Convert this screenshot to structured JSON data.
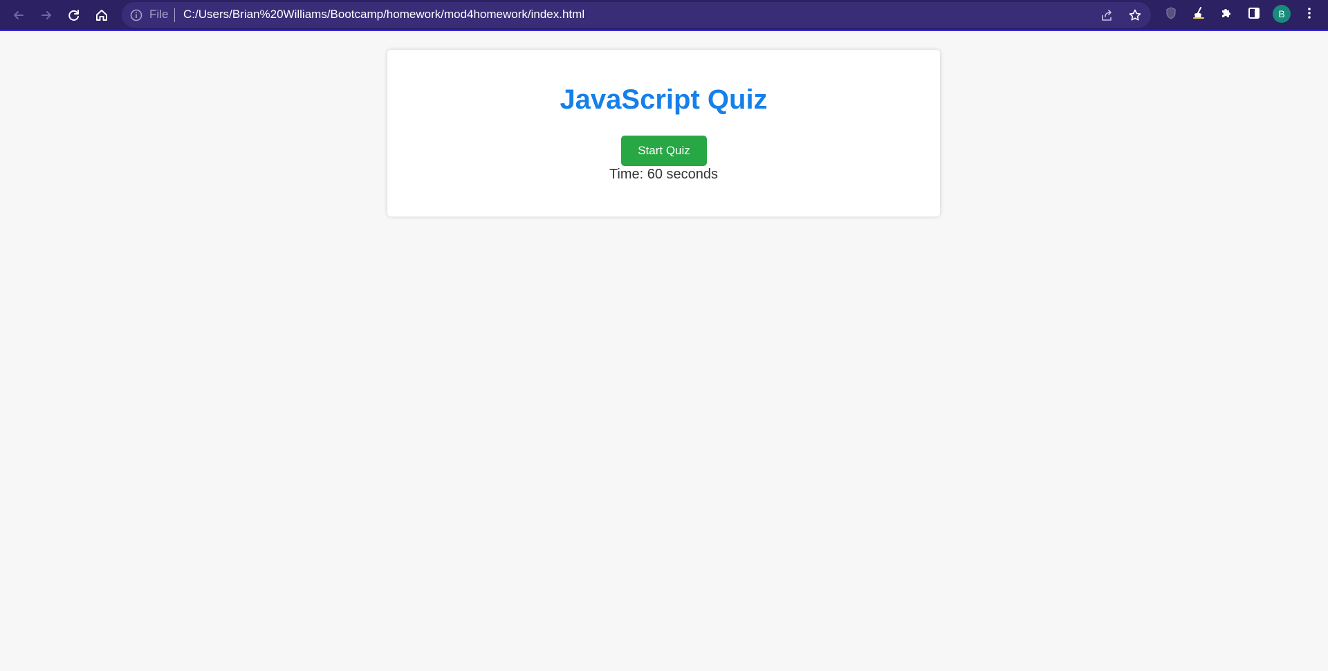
{
  "browser": {
    "scheme_label": "File",
    "url": "C:/Users/Brian%20Williams/Bootcamp/homework/mod4homework/index.html",
    "profile_initial": "B",
    "icons": {
      "back": "arrow-left-icon",
      "forward": "arrow-right-icon",
      "reload": "reload-icon",
      "home": "home-icon",
      "info": "info-icon",
      "share": "share-icon",
      "bookmark": "star-icon",
      "extension_shield": "shield-icon",
      "extension_broom": "broom-icon",
      "extensions": "puzzle-icon",
      "side_panel": "side-panel-icon",
      "menu": "kebab-menu-icon"
    },
    "colors": {
      "toolbar": "#2b2163",
      "omnibox": "#3a2d78",
      "avatar": "#1a8a7a"
    }
  },
  "quiz": {
    "title": "JavaScript Quiz",
    "start_label": "Start Quiz",
    "timer_text": "Time: 60 seconds",
    "colors": {
      "title": "#1580ea",
      "start_button": "#28a745",
      "background": "#f7f7f7"
    }
  }
}
